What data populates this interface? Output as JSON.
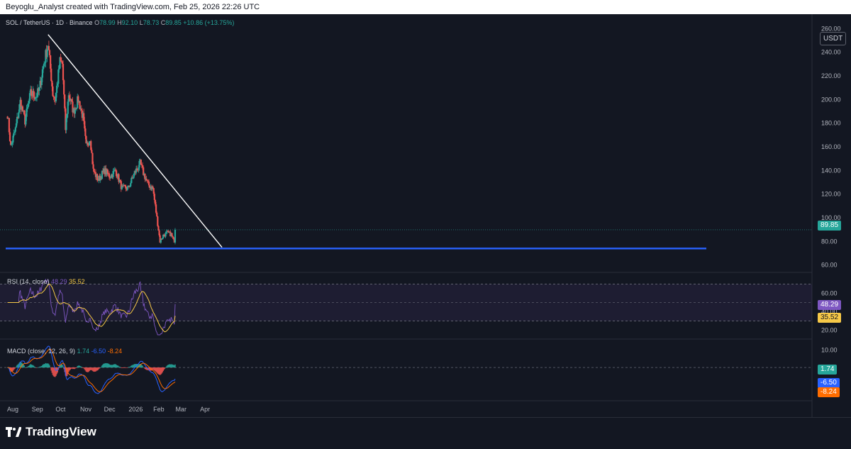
{
  "header": {
    "attribution": "Beyoglu_Analyst created with TradingView.com, Feb 25, 2026 22:26 UTC"
  },
  "legend": {
    "symbol": "SOL / TetherUS · 1D · Binance",
    "o_label": "O",
    "o_value": "78.99",
    "h_label": "H",
    "h_value": "92.10",
    "l_label": "L",
    "l_value": "78.73",
    "c_label": "C",
    "c_value": "89.85",
    "change": "+10.86 (+13.75%)"
  },
  "currency_button": "USDT",
  "rsi_legend": {
    "label": "RSI (14, close)",
    "value1": "48.29",
    "value2": "35.52"
  },
  "macd_legend": {
    "label": "MACD (close, 12, 26, 9)",
    "value1": "1.74",
    "value2": "-6.50",
    "value3": "-8.24"
  },
  "badges": {
    "price": "89.85",
    "rsi": "48.29",
    "rsi_ma": "35.52",
    "hist": "1.74",
    "macd": "-6.50",
    "signal": "-8.24"
  },
  "footer": {
    "logo_text": "TradingView"
  },
  "colors": {
    "up": "#26a69a",
    "down": "#ef5350",
    "support": "#2962ff",
    "trend": "#ffffff",
    "rsi": "#7e57c2",
    "rsi_ma": "#f7c948",
    "macd": "#2962ff",
    "signal": "#ff6d00"
  },
  "chart_data": [
    {
      "type": "candlestick",
      "title": "SOL / TetherUS · 1D · Binance",
      "ylim": [
        55,
        265
      ],
      "y_ticks": [
        "260.00",
        "240.00",
        "220.00",
        "200.00",
        "180.00",
        "160.00",
        "140.00",
        "120.00",
        "100.00",
        "80.00",
        "60.00"
      ],
      "x_ticks": [
        "Aug",
        "Sep",
        "Oct",
        "Nov",
        "Dec",
        "2026",
        "Feb",
        "Mar",
        "Apr"
      ],
      "last_price": 89.85,
      "support_level": 74,
      "trendline": {
        "from": [
          "2025-09-18",
          255
        ],
        "to": [
          "2026-04-25",
          75
        ]
      },
      "close_path": [
        [
          "2025-07-29",
          188
        ],
        [
          "2025-08-02",
          160
        ],
        [
          "2025-08-08",
          175
        ],
        [
          "2025-08-14",
          198
        ],
        [
          "2025-08-20",
          182
        ],
        [
          "2025-08-27",
          205
        ],
        [
          "2025-09-03",
          203
        ],
        [
          "2025-09-07",
          208
        ],
        [
          "2025-09-11",
          225
        ],
        [
          "2025-09-18",
          247
        ],
        [
          "2025-09-24",
          205
        ],
        [
          "2025-09-27",
          200
        ],
        [
          "2025-10-03",
          232
        ],
        [
          "2025-10-06",
          230
        ],
        [
          "2025-10-10",
          175
        ],
        [
          "2025-10-14",
          205
        ],
        [
          "2025-10-20",
          190
        ],
        [
          "2025-10-26",
          200
        ],
        [
          "2025-11-01",
          185
        ],
        [
          "2025-11-05",
          160
        ],
        [
          "2025-11-10",
          168
        ],
        [
          "2025-11-14",
          140
        ],
        [
          "2025-11-20",
          132
        ],
        [
          "2025-11-28",
          140
        ],
        [
          "2025-12-05",
          135
        ],
        [
          "2025-12-12",
          140
        ],
        [
          "2025-12-20",
          125
        ],
        [
          "2025-12-28",
          125
        ],
        [
          "2026-01-05",
          138
        ],
        [
          "2026-01-12",
          146
        ],
        [
          "2026-01-16",
          138
        ],
        [
          "2026-01-22",
          128
        ],
        [
          "2026-01-28",
          125
        ],
        [
          "2026-02-01",
          105
        ],
        [
          "2026-02-06",
          80
        ],
        [
          "2026-02-10",
          85
        ],
        [
          "2026-02-15",
          87
        ],
        [
          "2026-02-20",
          86
        ],
        [
          "2026-02-24",
          79
        ],
        [
          "2026-02-25",
          89.85
        ]
      ]
    },
    {
      "type": "line",
      "name": "RSI (14, close)",
      "ylim": [
        15,
        75
      ],
      "y_ticks": [
        "60.00",
        "40.00",
        "20.00"
      ],
      "bands": [
        70,
        30
      ],
      "last_rsi": 48.29,
      "last_ma": 35.52
    },
    {
      "type": "line",
      "name": "MACD (close, 12, 26, 9)",
      "ylim": [
        -17,
        13
      ],
      "y_ticks": [
        "10.00"
      ],
      "last_hist": 1.74,
      "last_macd": -6.5,
      "last_signal": -8.24
    }
  ]
}
